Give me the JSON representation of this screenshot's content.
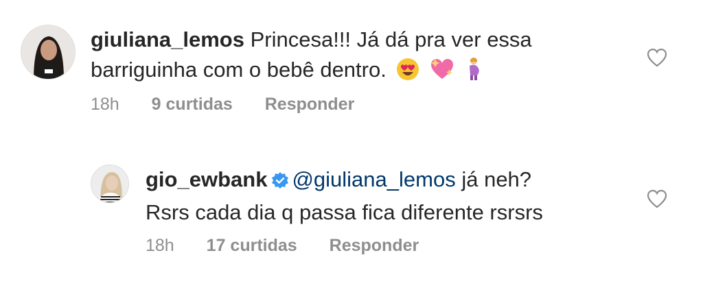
{
  "comments": [
    {
      "username": "giuliana_lemos",
      "text_line1": "Princesa!!! Já dá pra ver essa",
      "text_line2": "barriguinha com o bebê dentro.",
      "emojis": [
        "heart-eyes-emoji",
        "sparkling-heart-emoji",
        "pregnant-woman-emoji"
      ],
      "time": "18h",
      "likes": "9 curtidas",
      "reply_label": "Responder"
    },
    {
      "username": "gio_ewbank",
      "verified": true,
      "mention": "@giuliana_lemos",
      "text_after_mention": " já neh?",
      "text_line2": "Rsrs cada dia q passa fica diferente rsrsrs",
      "time": "18h",
      "likes": "17 curtidas",
      "reply_label": "Responder"
    }
  ],
  "colors": {
    "text": "#262626",
    "meta": "#8e8e8e",
    "mention": "#00376b",
    "verified": "#3897f0"
  }
}
